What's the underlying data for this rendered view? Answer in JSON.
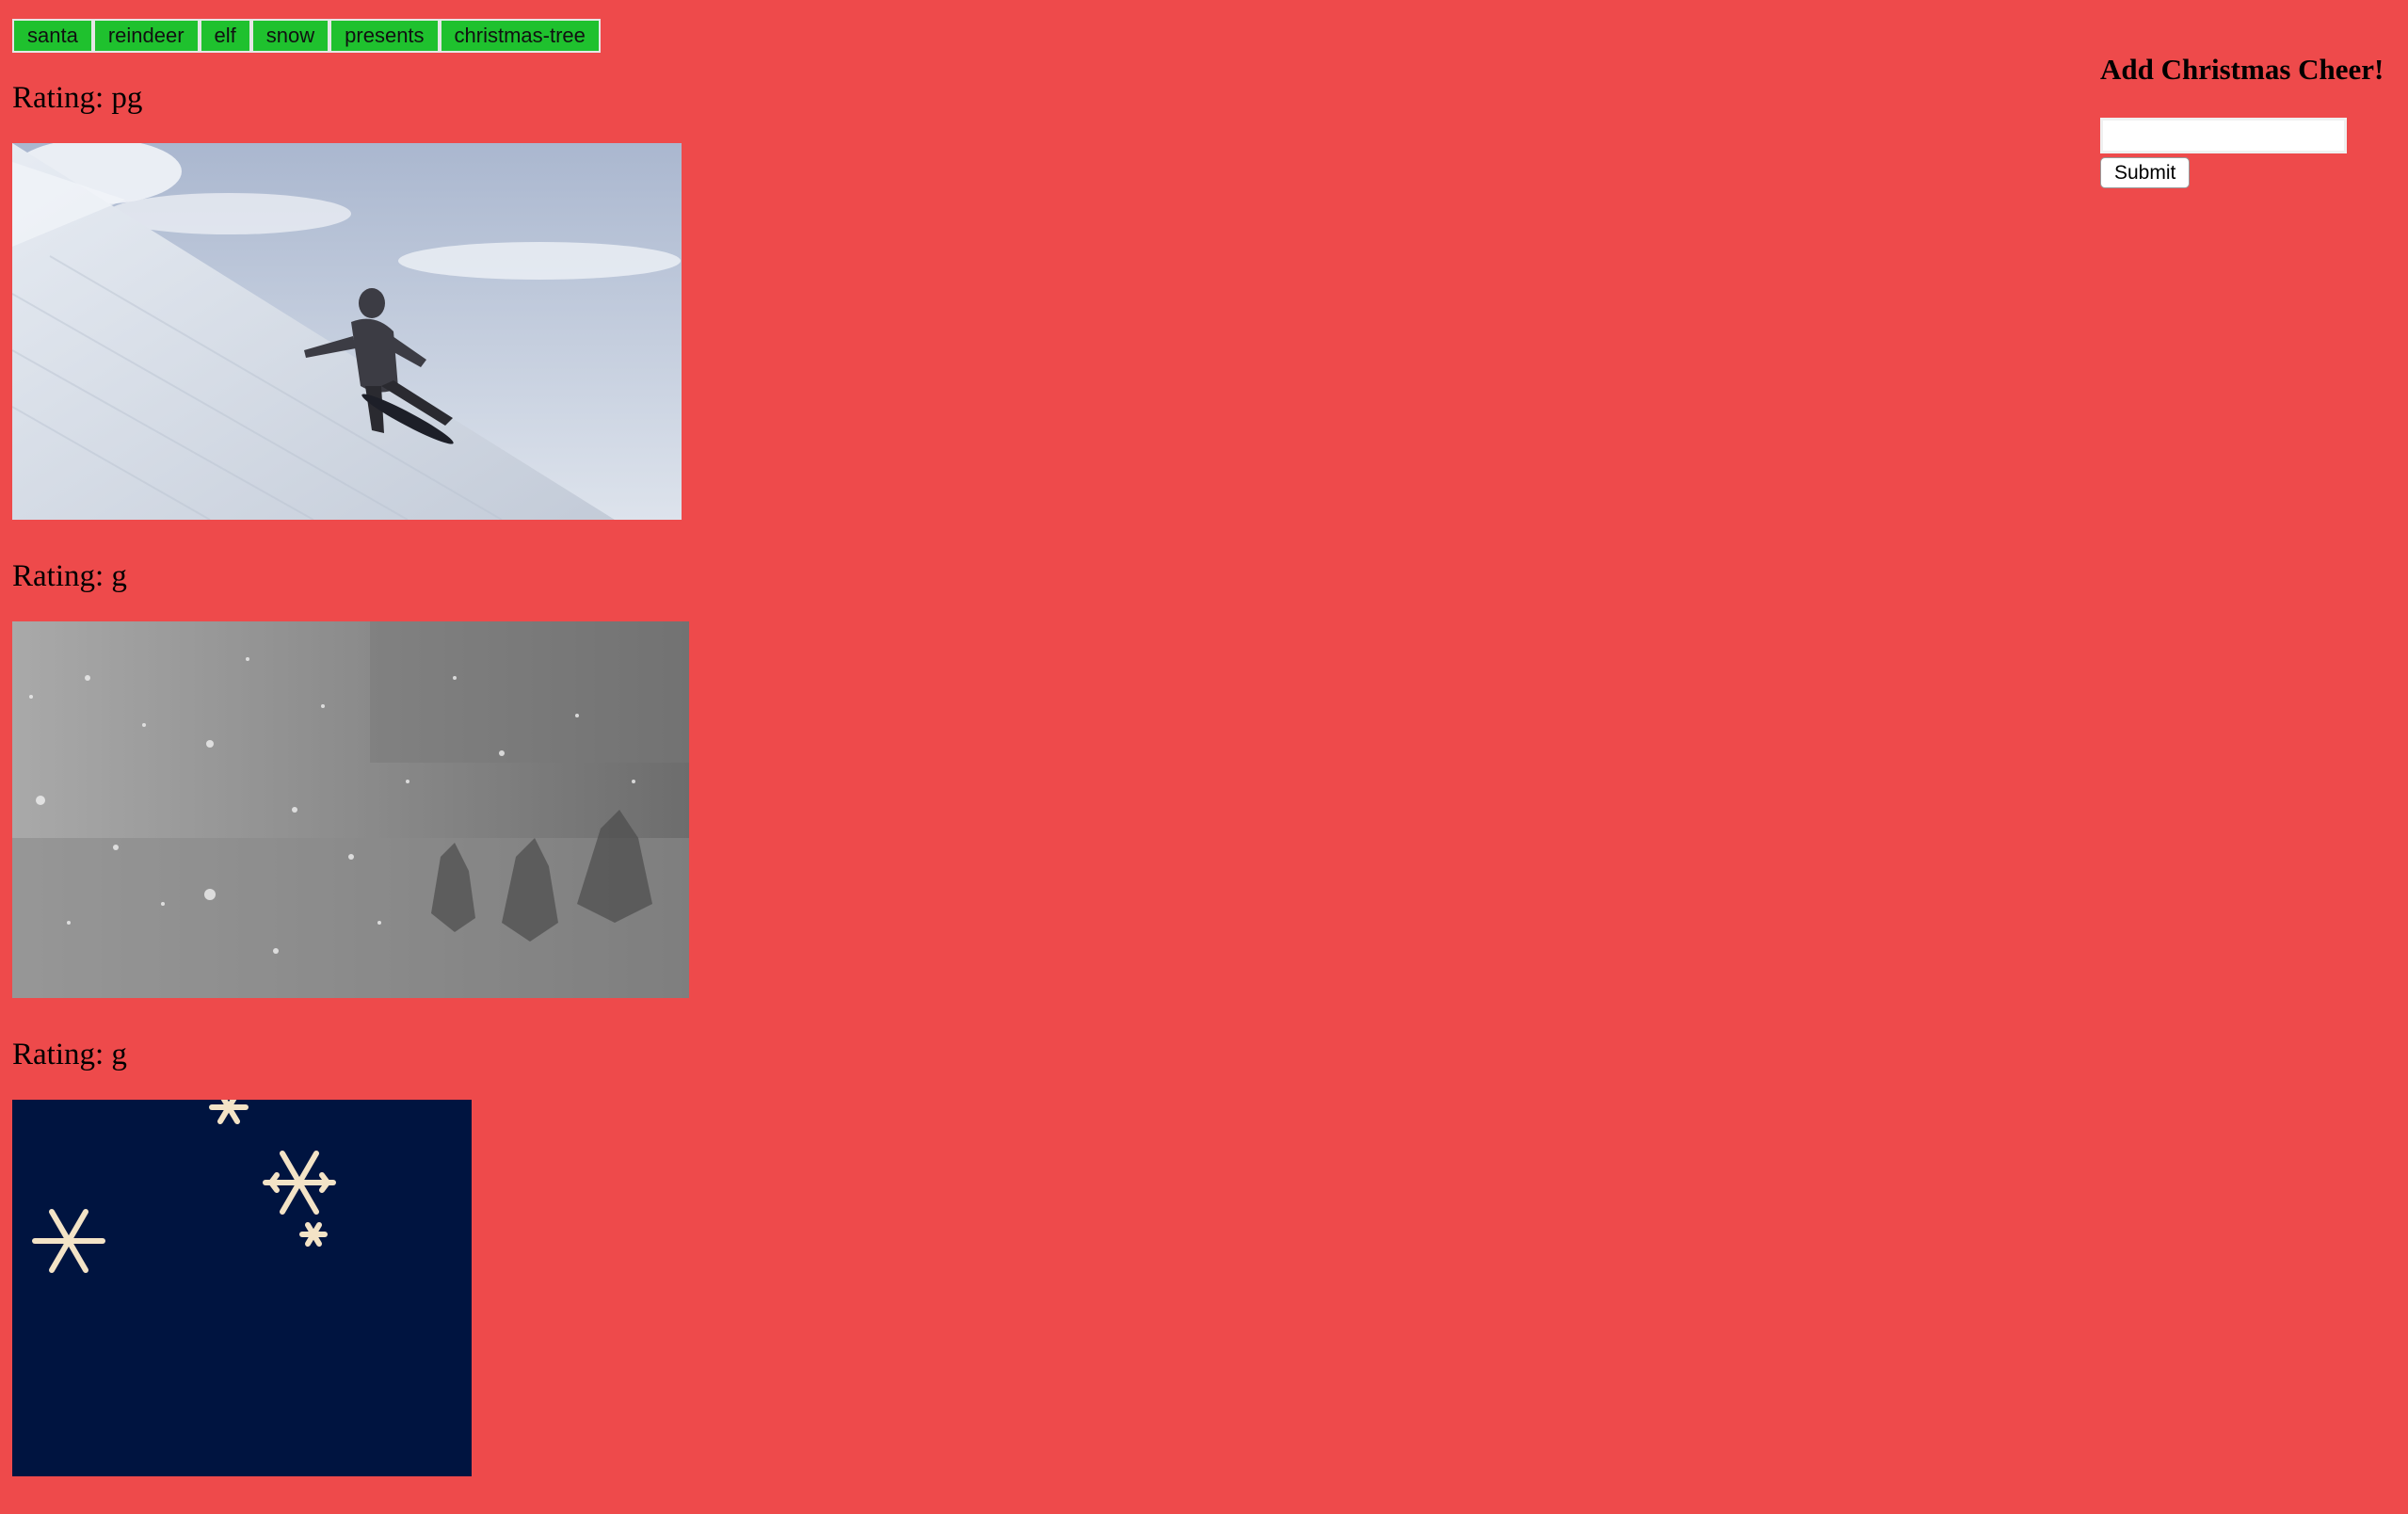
{
  "tags": [
    "santa",
    "reindeer",
    "elf",
    "snow",
    "presents",
    "christmas-tree"
  ],
  "results": [
    {
      "rating_label": "Rating: pg",
      "image": "snowboarder-on-snowy-slope-gif"
    },
    {
      "rating_label": "Rating: g",
      "image": "snowstorm-forest-gif"
    },
    {
      "rating_label": "Rating: g",
      "image": "snowflakes-on-navy-gif"
    }
  ],
  "form": {
    "heading": "Add Christmas Cheer!",
    "input_value": "",
    "input_placeholder": "",
    "submit_label": "Submit"
  },
  "colors": {
    "background": "#ee4a4b",
    "tag_button": "#1fc12e",
    "snowflake_bg": "#001440"
  }
}
